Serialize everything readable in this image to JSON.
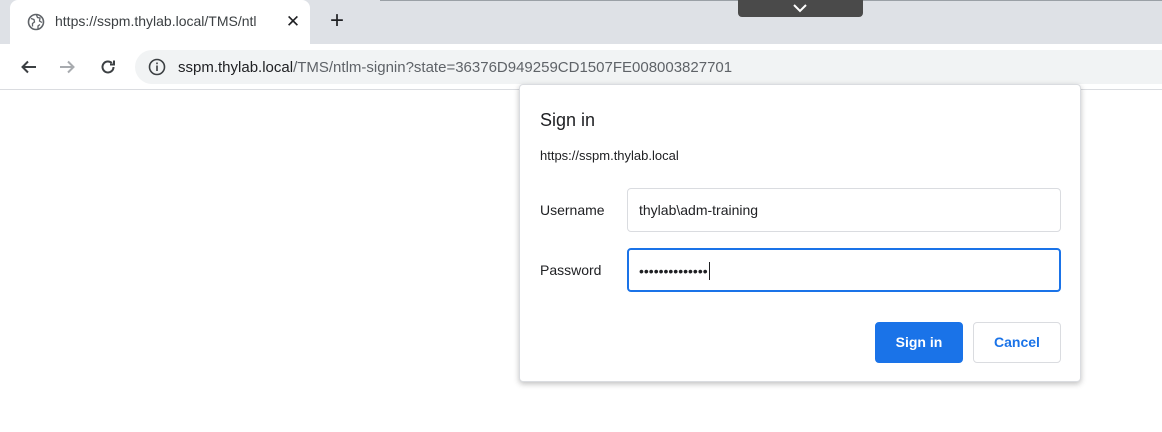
{
  "tab": {
    "title": "https://sspm.thylab.local/TMS/ntl",
    "icon": "globe-icon",
    "close_icon": "close-icon"
  },
  "toolbar": {
    "back_icon": "arrow-left-icon",
    "forward_icon": "arrow-right-icon",
    "reload_icon": "reload-icon",
    "info_icon": "info-icon",
    "url_host": "sspm.thylab.local",
    "url_path": "/TMS/ntlm-signin?state=36376D949259CD1507FE008003827701"
  },
  "dialog": {
    "title": "Sign in",
    "origin": "https://sspm.thylab.local",
    "username_label": "Username",
    "username_value": "thylab\\adm-training",
    "password_label": "Password",
    "password_value": "••••••••••••••",
    "signin_label": "Sign in",
    "cancel_label": "Cancel"
  },
  "colors": {
    "accent": "#1a73e8",
    "tabstrip": "#dee1e6",
    "omnibox": "#f1f3f4"
  }
}
